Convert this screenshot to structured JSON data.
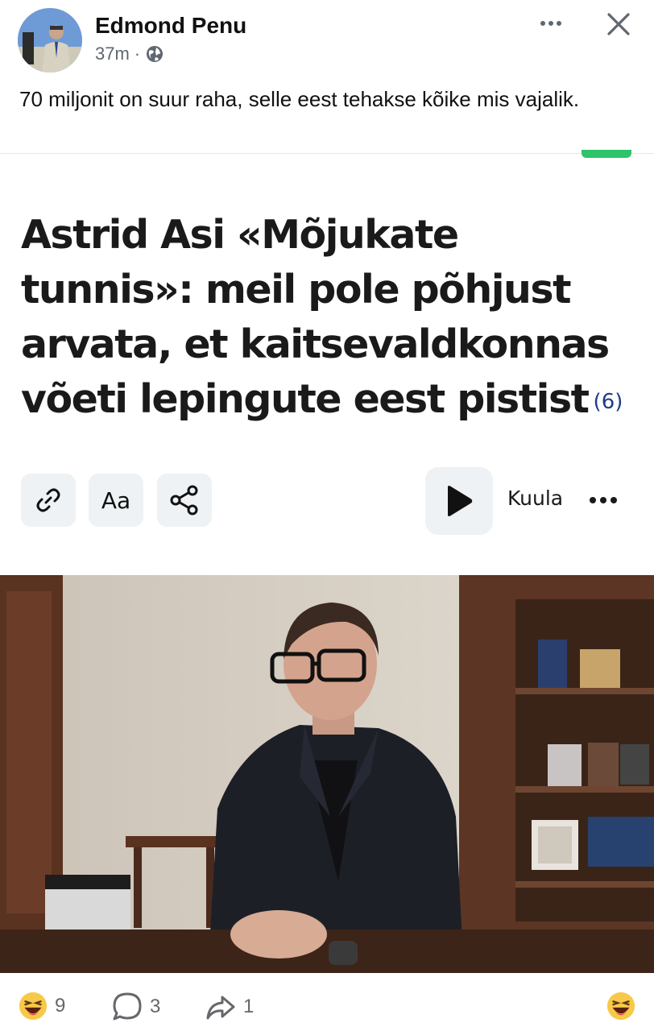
{
  "post": {
    "author": "Edmond Penu",
    "time": "37m",
    "separator": "·",
    "visibility_icon": "globe-icon",
    "text": "70 miljonit on suur raha, selle eest tehakse kõike mis vajalik."
  },
  "article": {
    "headline": "Astrid Asi «Mõjukate tunnis»: meil pole põhjust arvata, et kaitsevaldkonnas võeti lepingute eest pistist",
    "comment_count": "(6)",
    "tools": {
      "link_icon": "link-icon",
      "text_size_label": "Aa",
      "share_icon": "share-icon"
    },
    "listen_label": "Kuula",
    "play_icon": "play-icon"
  },
  "reactions": {
    "emoji_icon": "laughing-emoji-icon",
    "reaction_count": "9",
    "comment_count": "3",
    "share_count": "1"
  },
  "colors": {
    "accent_green": "#2fc36b",
    "comment_count_blue": "#1f3a8a",
    "button_bg": "#eef2f4"
  }
}
